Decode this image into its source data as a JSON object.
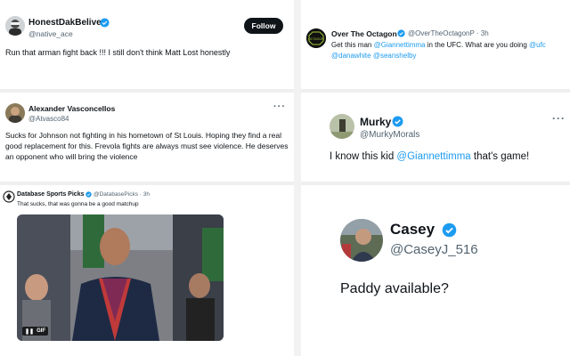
{
  "tweet1": {
    "name": "HonestDakBeliver",
    "handle": "@native_ace",
    "follow_label": "Follow",
    "text": "Run that arman fight back !!! I still don't think Matt Lost honestly"
  },
  "tweet2": {
    "name": "Over The Octagon",
    "handle": "@OverTheOctagonP",
    "time": "· 3h",
    "avatar_text": "OCTAGON",
    "text_prefix": "Get this man ",
    "mention1": "@Giannettimma",
    "text_mid": " in the UFC. What are you doing ",
    "mention2": "@ufc",
    "mention3": "@danawhite",
    "mention4": "@seanshelby"
  },
  "tweet3": {
    "name": "Alexander Vasconcellos",
    "handle": "@Atvasco84",
    "more": "···",
    "text": "Sucks for Johnson not fighting in his hometown of St Louis. Hoping they find a real good replacement for this. Frevola fights are always must see violence. He deserves an opponent who will bring the violence"
  },
  "tweet4": {
    "name": "Murky",
    "handle": "@MurkyMorals",
    "more": "···",
    "text_prefix": "I know this kid ",
    "mention": "@Giannettimma",
    "text_suffix": " that's game!"
  },
  "tweet5": {
    "name": "Database Sports Picks",
    "handle": "@DatabasePicks",
    "time": "· 3h",
    "text": "That sucks, that was gonna be a good matchup",
    "gif_label": "GIF"
  },
  "tweet6": {
    "name": "Casey",
    "handle": "@CaseyJ_516",
    "text": "Paddy available?"
  },
  "colors": {
    "verified": "#1d9bf0",
    "link": "#1d9bf0",
    "handle": "#536471",
    "button": "#0f1419"
  }
}
